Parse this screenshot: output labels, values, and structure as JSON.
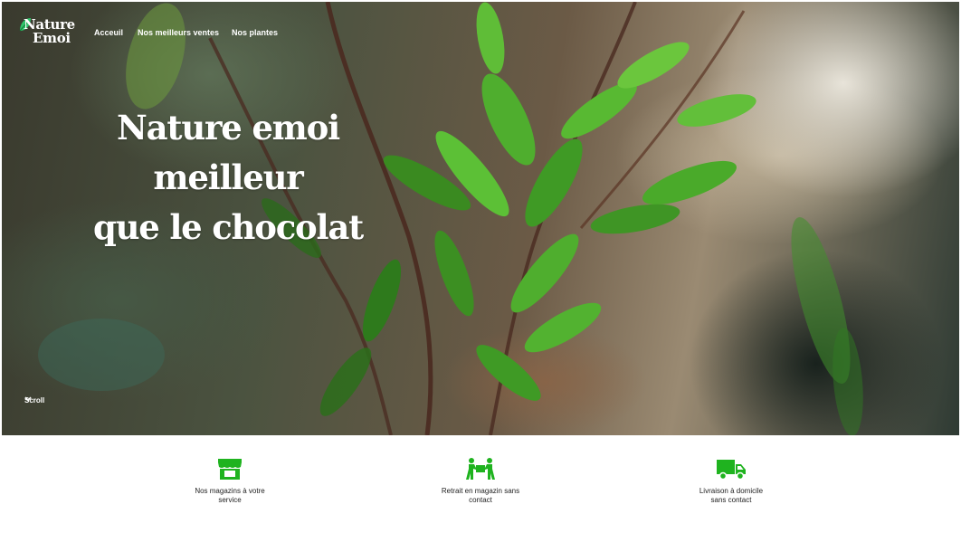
{
  "logo": {
    "line1": "Nature",
    "line2": "Emoi"
  },
  "nav": {
    "items": [
      {
        "label": "Acceuil"
      },
      {
        "label": "Nos meilleurs ventes"
      },
      {
        "label": "Nos plantes"
      }
    ]
  },
  "hero": {
    "title_line1": "Nature emoi meilleur",
    "title_line2": "que le chocolat",
    "scroll_label": "Scroll"
  },
  "features": [
    {
      "icon": "store-icon",
      "label_line1": "Nos magazins à votre",
      "label_line2": "service"
    },
    {
      "icon": "people-carrying-box-icon",
      "label_line1": "Retrait en magazin sans",
      "label_line2": "contact"
    },
    {
      "icon": "delivery-truck-icon",
      "label_line1": "Livraison à domicile",
      "label_line2": "sans contact"
    }
  ],
  "colors": {
    "accent": "#1fb31f",
    "hero_text": "#ffffff",
    "body_text": "#222222"
  }
}
